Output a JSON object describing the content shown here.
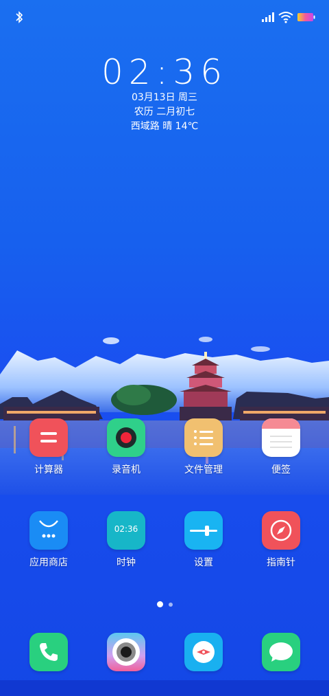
{
  "status_bar": {
    "bluetooth_icon": "bluetooth-icon",
    "signal_icon": "signal-icon",
    "wifi_icon": "wifi-icon",
    "battery_icon": "battery-icon"
  },
  "clock_widget": {
    "time": "02:36",
    "date": "03月13日 周三",
    "lunar": "农历 二月初七",
    "weather": "西域路 晴 14℃"
  },
  "apps": [
    {
      "label": "计算器",
      "icon": "calculator-icon",
      "color": "#f0525a"
    },
    {
      "label": "录音机",
      "icon": "recorder-icon",
      "color": "#2fd08a"
    },
    {
      "label": "文件管理",
      "icon": "file-manager-icon",
      "color": "#f1c070"
    },
    {
      "label": "便签",
      "icon": "notes-icon",
      "color": "#ffffff"
    },
    {
      "label": "应用商店",
      "icon": "app-store-icon",
      "color": "#1a8cf5"
    },
    {
      "label": "时钟",
      "icon": "clock-icon",
      "color": "#17b6c8",
      "face_text": "02:36"
    },
    {
      "label": "设置",
      "icon": "settings-icon",
      "color": "#19b4f2"
    },
    {
      "label": "指南针",
      "icon": "compass-icon",
      "color": "#f0525a"
    }
  ],
  "page_indicator": {
    "pages": 2,
    "current": 1
  },
  "dock": [
    {
      "icon": "phone-icon",
      "color": "#29d07f"
    },
    {
      "icon": "camera-icon",
      "color": "#5cc8f0"
    },
    {
      "icon": "browser-icon",
      "color": "#19b0f0"
    },
    {
      "icon": "messages-icon",
      "color": "#29d07f"
    }
  ]
}
